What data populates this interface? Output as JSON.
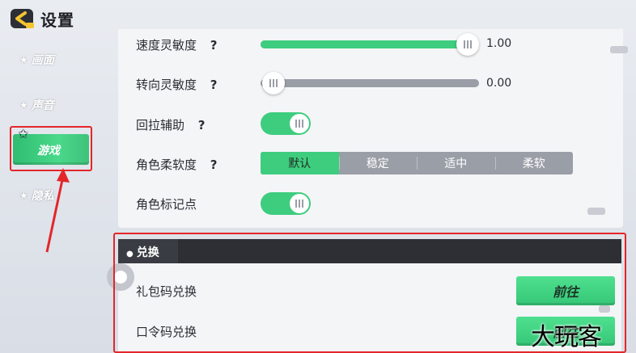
{
  "header": {
    "title": "设置",
    "back_icon": "back-arrow-icon"
  },
  "sidebar": {
    "items": [
      {
        "label": "画面",
        "icon": "star-icon"
      },
      {
        "label": "声音",
        "icon": "star-icon"
      },
      {
        "label": "游戏",
        "icon": "star-icon",
        "active": true
      },
      {
        "label": "隐私",
        "icon": "star-icon"
      }
    ]
  },
  "settings": {
    "speed_sensitivity": {
      "label": "速度灵敏度",
      "help": "?",
      "value": 1.0,
      "value_text": "1.00"
    },
    "turn_sensitivity": {
      "label": "转向灵敏度",
      "help": "?",
      "value": 0.0,
      "value_text": "0.00"
    },
    "pullback_assist": {
      "label": "回拉辅助",
      "help": "?",
      "on": true
    },
    "character_softness": {
      "label": "角色柔软度",
      "help": "?",
      "options": [
        "默认",
        "稳定",
        "适中",
        "柔软"
      ],
      "selected": "默认"
    },
    "character_marker": {
      "label": "角色标记点",
      "on": true
    }
  },
  "exchange": {
    "title": "兑换",
    "gift_code": {
      "label": "礼包码兑换",
      "button": "前往"
    },
    "password_code": {
      "label": "口令码兑换",
      "button": "前往"
    }
  },
  "watermark": "大玩客",
  "colors": {
    "accent": "#3ecd7e",
    "highlight": "#e3262a",
    "dark_header": "#2d2f35"
  }
}
